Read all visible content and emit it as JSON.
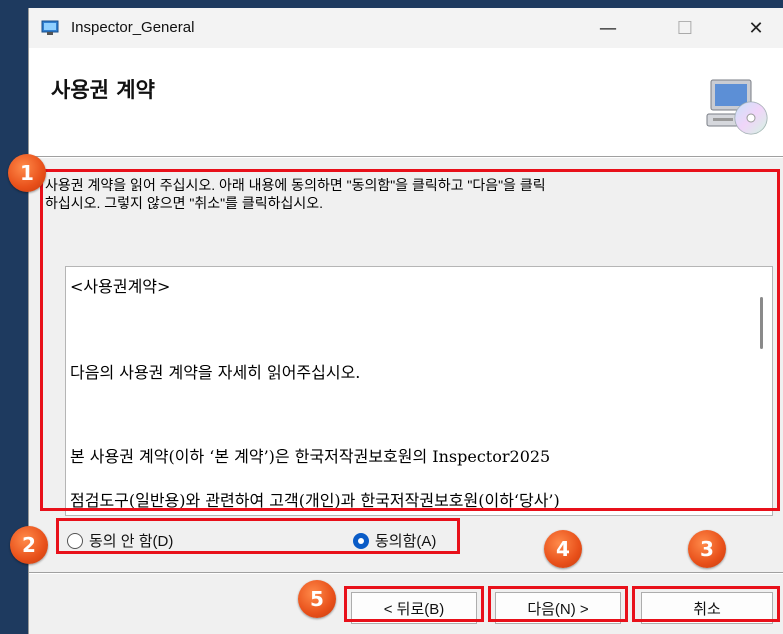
{
  "window": {
    "title": "Inspector_General",
    "minimize_glyph": "—",
    "maximize_glyph": "☐",
    "close_glyph": "✕"
  },
  "header": {
    "title": "사용권 계약",
    "icon": "computer-cd-icon"
  },
  "instructions": {
    "line1": "사용권 계약을 읽어 주십시오. 아래 내용에 동의하면 \"동의함\"을 클릭하고 \"다음\"을 클릭",
    "line2": "하십시오. 그렇지 않으면 \"취소\"를 클릭하십시오."
  },
  "license": {
    "lines": [
      "<사용권계약>",
      "다음의 사용권 계약을 자세히 읽어주십시오.",
      "본 사용권 계약(이하 ‘본 계약’)은 한국저작권보호원의 Inspector2025",
      "점검도구(일반용)와 관련하여 고객(개인)과 한국저작권보호원(이하‘당사’)"
    ]
  },
  "radios": {
    "disagree_label": "동의 안 함(D)",
    "agree_label": "동의함(A)",
    "selected": "agree"
  },
  "buttons": {
    "back": "< 뒤로(B)",
    "next": "다음(N) >",
    "cancel": "취소"
  },
  "annotations": {
    "badges": [
      "1",
      "2",
      "3",
      "4",
      "5"
    ],
    "highlight_color": "#e8101a",
    "badge_color": "#e8501a"
  }
}
